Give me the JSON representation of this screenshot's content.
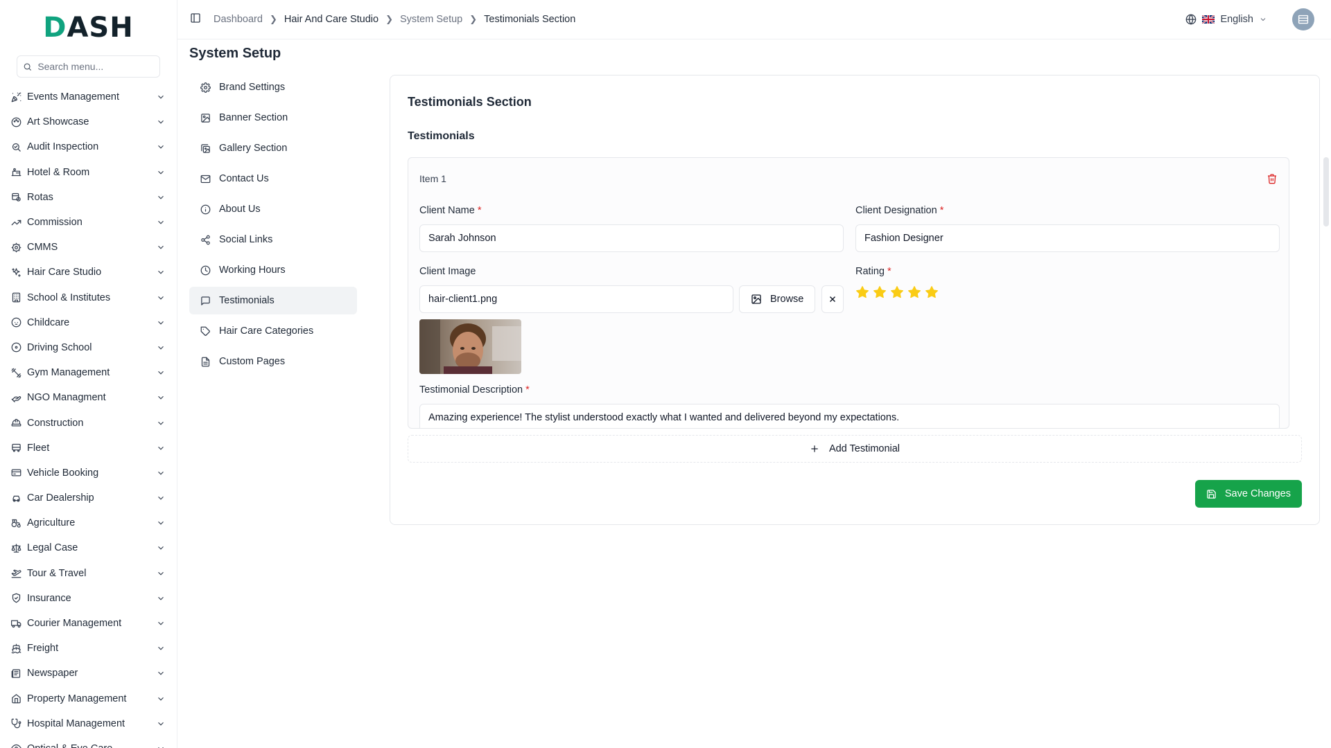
{
  "app": {
    "logo": {
      "first": "D",
      "rest": "ASH"
    },
    "brand_color": "#10a37f"
  },
  "sidebar": {
    "search_placeholder": "Search menu...",
    "items": [
      {
        "label": "Events Management",
        "icon": "party-popper-icon"
      },
      {
        "label": "Art Showcase",
        "icon": "palette-icon"
      },
      {
        "label": "Audit Inspection",
        "icon": "search-check-icon"
      },
      {
        "label": "Hotel & Room",
        "icon": "hotel-icon"
      },
      {
        "label": "Rotas",
        "icon": "calendar-clock-icon"
      },
      {
        "label": "Commission",
        "icon": "trending-up-icon"
      },
      {
        "label": "CMMS",
        "icon": "cog-icon"
      },
      {
        "label": "Hair Care Studio",
        "icon": "sparkles-icon"
      },
      {
        "label": "School & Institutes",
        "icon": "building-icon"
      },
      {
        "label": "Childcare",
        "icon": "baby-icon"
      },
      {
        "label": "Driving School",
        "icon": "steering-wheel-icon"
      },
      {
        "label": "Gym Management",
        "icon": "dumbbell-icon"
      },
      {
        "label": "NGO Managment",
        "icon": "hand-heart-icon"
      },
      {
        "label": "Construction",
        "icon": "hard-hat-icon"
      },
      {
        "label": "Fleet",
        "icon": "bus-icon"
      },
      {
        "label": "Vehicle Booking",
        "icon": "car-ticket-icon"
      },
      {
        "label": "Car Dealership",
        "icon": "car-icon"
      },
      {
        "label": "Agriculture",
        "icon": "tractor-icon"
      },
      {
        "label": "Legal Case",
        "icon": "scale-icon"
      },
      {
        "label": "Tour & Travel",
        "icon": "plane-icon"
      },
      {
        "label": "Insurance",
        "icon": "shield-check-icon"
      },
      {
        "label": "Courier Management",
        "icon": "truck-icon"
      },
      {
        "label": "Freight",
        "icon": "ship-icon"
      },
      {
        "label": "Newspaper",
        "icon": "newspaper-icon"
      },
      {
        "label": "Property Management",
        "icon": "home-icon"
      },
      {
        "label": "Hospital Management",
        "icon": "stethoscope-icon"
      },
      {
        "label": "Optical & Eye Care",
        "icon": "eye-icon"
      }
    ]
  },
  "header": {
    "breadcrumbs": [
      "Dashboard",
      "Hair And Care Studio",
      "System Setup",
      "Testimonials Section"
    ],
    "language": "English"
  },
  "page": {
    "title": "System Setup",
    "sub_nav": [
      {
        "label": "Brand Settings",
        "icon": "settings-icon"
      },
      {
        "label": "Banner Section",
        "icon": "image-icon"
      },
      {
        "label": "Gallery Section",
        "icon": "images-icon"
      },
      {
        "label": "Contact Us",
        "icon": "mail-icon"
      },
      {
        "label": "About Us",
        "icon": "info-icon"
      },
      {
        "label": "Social Links",
        "icon": "share-icon"
      },
      {
        "label": "Working Hours",
        "icon": "clock-icon"
      },
      {
        "label": "Testimonials",
        "icon": "message-square-icon",
        "active": true
      },
      {
        "label": "Hair Care Categories",
        "icon": "tag-icon"
      },
      {
        "label": "Custom Pages",
        "icon": "file-text-icon"
      }
    ]
  },
  "form": {
    "card_title": "Testimonials Section",
    "section_title": "Testimonials",
    "item": {
      "title": "Item 1",
      "client_name_label": "Client Name",
      "client_name_value": "Sarah Johnson",
      "client_designation_label": "Client Designation",
      "client_designation_value": "Fashion Designer",
      "client_image_label": "Client Image",
      "client_image_value": "hair-client1.png",
      "browse_label": "Browse",
      "rating_label": "Rating",
      "rating_value": 5,
      "rating_max": 5,
      "description_label": "Testimonial Description",
      "description_value": "Amazing experience! The stylist understood exactly what I wanted and delivered beyond my expectations."
    },
    "required_mark": "*",
    "add_label": "Add Testimonial",
    "save_label": "Save Changes",
    "star_color": "#facc15",
    "save_color": "#16a34a",
    "danger_color": "#dc2626"
  }
}
